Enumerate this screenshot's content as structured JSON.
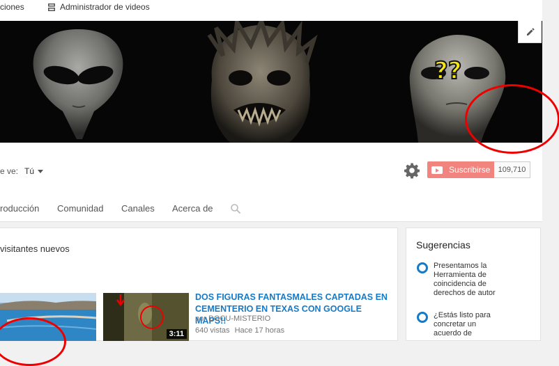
{
  "toolbar": {
    "item1_label": "ciones",
    "item2_label": "Administrador de videos"
  },
  "banner": {
    "overlay_text": "??"
  },
  "channel": {
    "view_as_label": "e ve:",
    "view_as_value": "Tú",
    "subscribe_label": "Suscribirse",
    "subscriber_count": "109,710"
  },
  "tabs": [
    {
      "label": "roducción"
    },
    {
      "label": "Comunidad"
    },
    {
      "label": "Canales"
    },
    {
      "label": "Acerca de"
    }
  ],
  "section": {
    "title": "visitantes nuevos"
  },
  "video": {
    "title": "DOS FIGURAS FANTASMALES CAPTADAS EN CEMENTERIO EN TEXAS CON GOOGLE MAPS!!",
    "author": "por DOCU-MISTERIO",
    "views": "640 vistas",
    "age": "Hace 17 horas",
    "duration": "3:11"
  },
  "suggestions": {
    "title": "Sugerencias",
    "items": [
      {
        "text": "Presentamos la Herramienta de coincidencia de derechos de autor"
      },
      {
        "text": "¿Estás listo para concretar un acuerdo de"
      }
    ]
  },
  "colors": {
    "link_blue": "#167ac6",
    "subscribe_red": "#e62117",
    "annotation_red": "#e00000"
  }
}
